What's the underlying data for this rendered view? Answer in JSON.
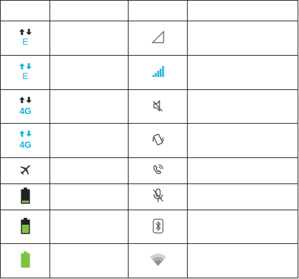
{
  "table": {
    "headers": [
      "",
      "",
      "",
      ""
    ],
    "rows": [
      {
        "left_icon": "data-e-inactive-icon",
        "left_text": "E",
        "left_desc": "",
        "right_icon": "no-signal-icon",
        "right_desc": ""
      },
      {
        "left_icon": "data-e-active-icon",
        "left_text": "E",
        "left_desc": "",
        "right_icon": "signal-strength-icon",
        "right_desc": ""
      },
      {
        "left_icon": "data-4g-inactive-icon",
        "left_text": "4G",
        "left_desc": "",
        "right_icon": "muted-speaker-icon",
        "right_desc": ""
      },
      {
        "left_icon": "data-4g-active-icon",
        "left_text": "4G",
        "left_desc": "",
        "right_icon": "vibrate-icon",
        "right_desc": ""
      },
      {
        "left_icon": "airplane-mode-icon",
        "left_desc": "",
        "right_icon": "speakerphone-icon",
        "right_desc": ""
      },
      {
        "left_icon": "battery-low-icon",
        "left_desc": "",
        "right_icon": "microphone-muted-icon",
        "right_desc": ""
      },
      {
        "left_icon": "battery-half-icon",
        "left_desc": "",
        "right_icon": "bluetooth-icon",
        "right_desc": ""
      },
      {
        "left_icon": "battery-full-icon",
        "left_desc": "",
        "right_icon": "wifi-icon",
        "right_desc": ""
      }
    ]
  },
  "colors": {
    "accent": "#1ab0e0",
    "inactive": "#222222",
    "battery_green": "#7cc242",
    "outline_gray": "#555555"
  }
}
